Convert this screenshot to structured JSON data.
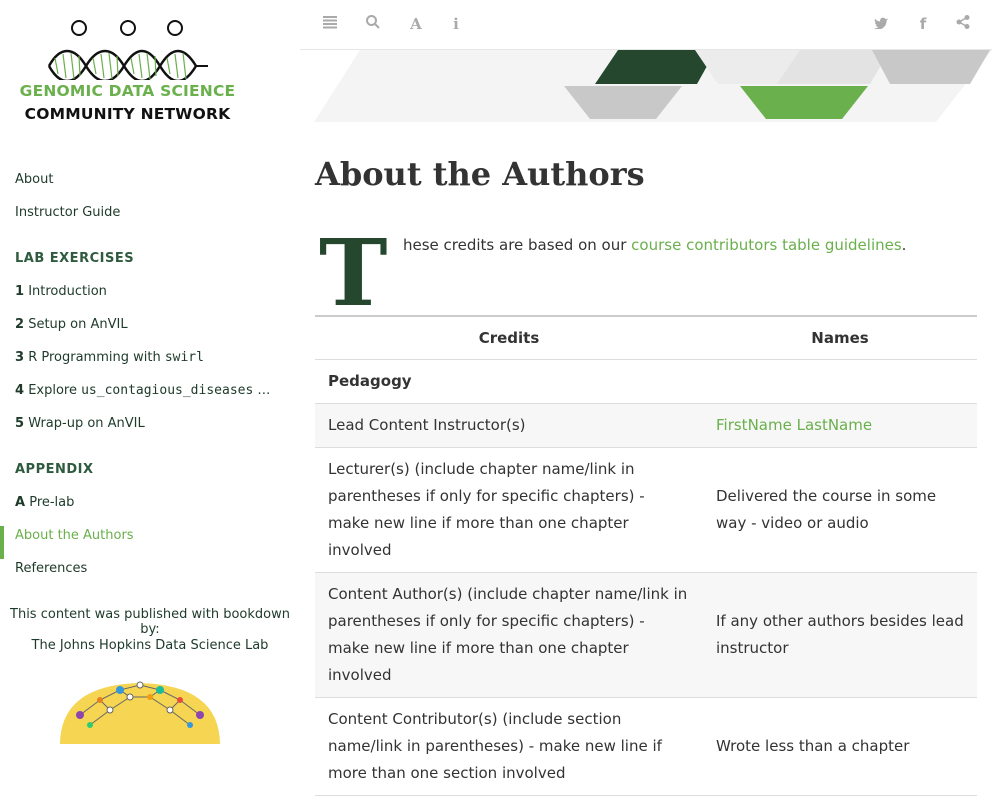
{
  "logo": {
    "line1": "GENOMIC DATA SCIENCE",
    "line2": "COMMUNITY NETWORK"
  },
  "sidebar": {
    "items": [
      {
        "label": "About"
      },
      {
        "label": "Instructor Guide"
      }
    ],
    "lab_header": "LAB EXERCISES",
    "lab_items": [
      {
        "num": "1",
        "label": "Introduction",
        "code": ""
      },
      {
        "num": "2",
        "label": "Setup on AnVIL",
        "code": ""
      },
      {
        "num": "3",
        "label": "R Programming with ",
        "code": "swirl"
      },
      {
        "num": "4",
        "label": "Explore ",
        "code": "us_contagious_diseases",
        "suffix": " …"
      },
      {
        "num": "5",
        "label": "Wrap-up on AnVIL",
        "code": ""
      }
    ],
    "appendix_header": "APPENDIX",
    "appendix_items": [
      {
        "num": "A",
        "label": "Pre-lab"
      }
    ],
    "active_item": "About the Authors",
    "references": "References",
    "published_by": "This content was published with bookdown by:",
    "lab_name": "The Johns Hopkins Data Science Lab"
  },
  "toolbar": {
    "icons": [
      "menu-icon",
      "search-icon",
      "font-icon",
      "info-icon",
      "twitter-icon",
      "facebook-icon",
      "share-icon"
    ]
  },
  "page": {
    "title": "About the Authors",
    "dropcap": "T",
    "intro_text": "hese credits are based on our ",
    "intro_link": "course contributors table guidelines",
    "intro_end": "."
  },
  "table": {
    "headers": [
      "Credits",
      "Names"
    ],
    "section": "Pedagogy",
    "rows": [
      {
        "credit": "Lead Content Instructor(s)",
        "name": "FirstName LastName",
        "link": true
      },
      {
        "credit": "Lecturer(s) (include chapter name/link in parentheses if only for specific chapters) - make new line if more than one chapter involved",
        "name": "Delivered the course in some way - video or audio",
        "link": false
      },
      {
        "credit": "Content Author(s) (include chapter name/link in parentheses if only for specific chapters) - make new line if more than one chapter involved",
        "name": "If any other authors besides lead instructor",
        "link": false
      },
      {
        "credit": "Content Contributor(s) (include section name/link in parentheses) - make new line if more than one section involved",
        "name": "Wrote less than a chapter",
        "link": false
      }
    ]
  },
  "colors": {
    "accent": "#6ab04c",
    "dark_green": "#25472d"
  }
}
